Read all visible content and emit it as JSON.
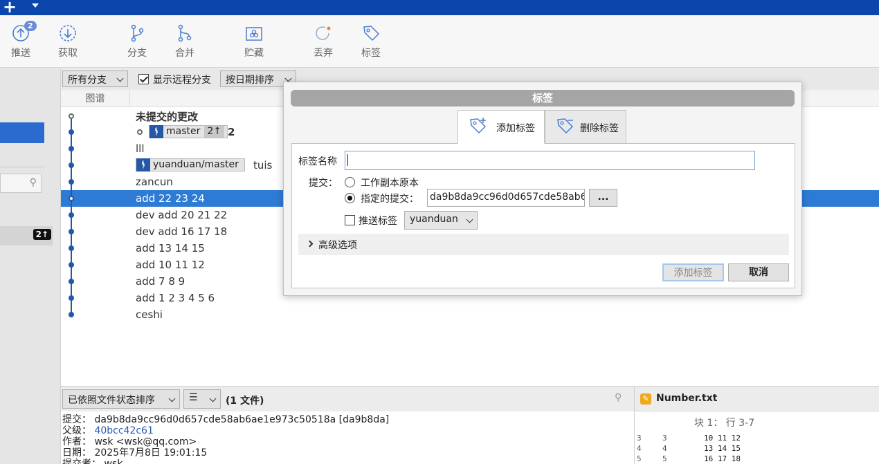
{
  "toolbar": {
    "push_label": "推送",
    "push_badge": "2",
    "fetch_label": "获取",
    "branch_label": "分支",
    "merge_label": "合并",
    "stash_label": "贮藏",
    "discard_label": "丢弃",
    "tag_label": "标签"
  },
  "filter": {
    "branches": "所有分支",
    "show_remote": "显示远程分支",
    "sort": "按日期排序"
  },
  "graph": {
    "header": "图谱",
    "rows": [
      {
        "message": "未提交的更改"
      },
      {
        "message": "2"
      },
      {
        "message": "lll"
      },
      {
        "message": "tuis"
      },
      {
        "message": "zancun"
      },
      {
        "message": "add 22 23 24"
      },
      {
        "message": "dev add 20 21 22"
      },
      {
        "message": "dev add 16 17 18"
      },
      {
        "message": "add 13 14 15"
      },
      {
        "message": "add 10 11 12"
      },
      {
        "message": "add 7 8 9"
      },
      {
        "message": "add 1 2 3 4 5 6"
      },
      {
        "message": "ceshi"
      }
    ],
    "master_chip": "master",
    "master_ahead": "2↑",
    "remote_chip": "yuanduan/master",
    "branch_glyph": "ᚬ"
  },
  "sidebar": {
    "ahead_count": "2↑"
  },
  "bottom": {
    "sort_label": "已依照文件状态排序",
    "view_glyph": "☰",
    "files_count": "(1 文件)",
    "commit_label": "提交：",
    "commit_value": "da9b8da9cc96d0d657cde58ab6ae1e973c50518a [da9b8da]",
    "parent_label": "父级：",
    "parent_value": "40bcc42c61",
    "author_label": "作者：",
    "author_value": "wsk <wsk@qq.com>",
    "date_label": "日期：",
    "date_value": "2025年7月8日 19:01:15",
    "committer_label": "提交者：",
    "committer_value": "wsk"
  },
  "file_pane": {
    "filename": "Number.txt",
    "hunk": "块 1： 行 3-7",
    "lines": [
      {
        "old": "3",
        "new": "3",
        "text": "10 11 12"
      },
      {
        "old": "4",
        "new": "4",
        "text": "13 14 15"
      },
      {
        "old": "5",
        "new": "5",
        "text": "16 17 18"
      }
    ]
  },
  "dialog": {
    "title": "标签",
    "tab_add": "添加标签",
    "tab_remove": "删除标签",
    "tag_name_label": "标签名称",
    "tag_name_value": "",
    "commit_label": "提交：",
    "option_working": "工作副本原本",
    "option_specified": "指定的提交：",
    "commit_hash": "da9b8da9cc96d0d657cde58ab6",
    "browse": "...",
    "push_tag_label": "推送标签",
    "remote": "yuanduan",
    "advanced": "高级选项",
    "ok": "添加标签",
    "cancel": "取消"
  },
  "colors": {
    "accent": "#0b46ad",
    "selection": "#2e7bd6",
    "graph": "#2458a6"
  }
}
